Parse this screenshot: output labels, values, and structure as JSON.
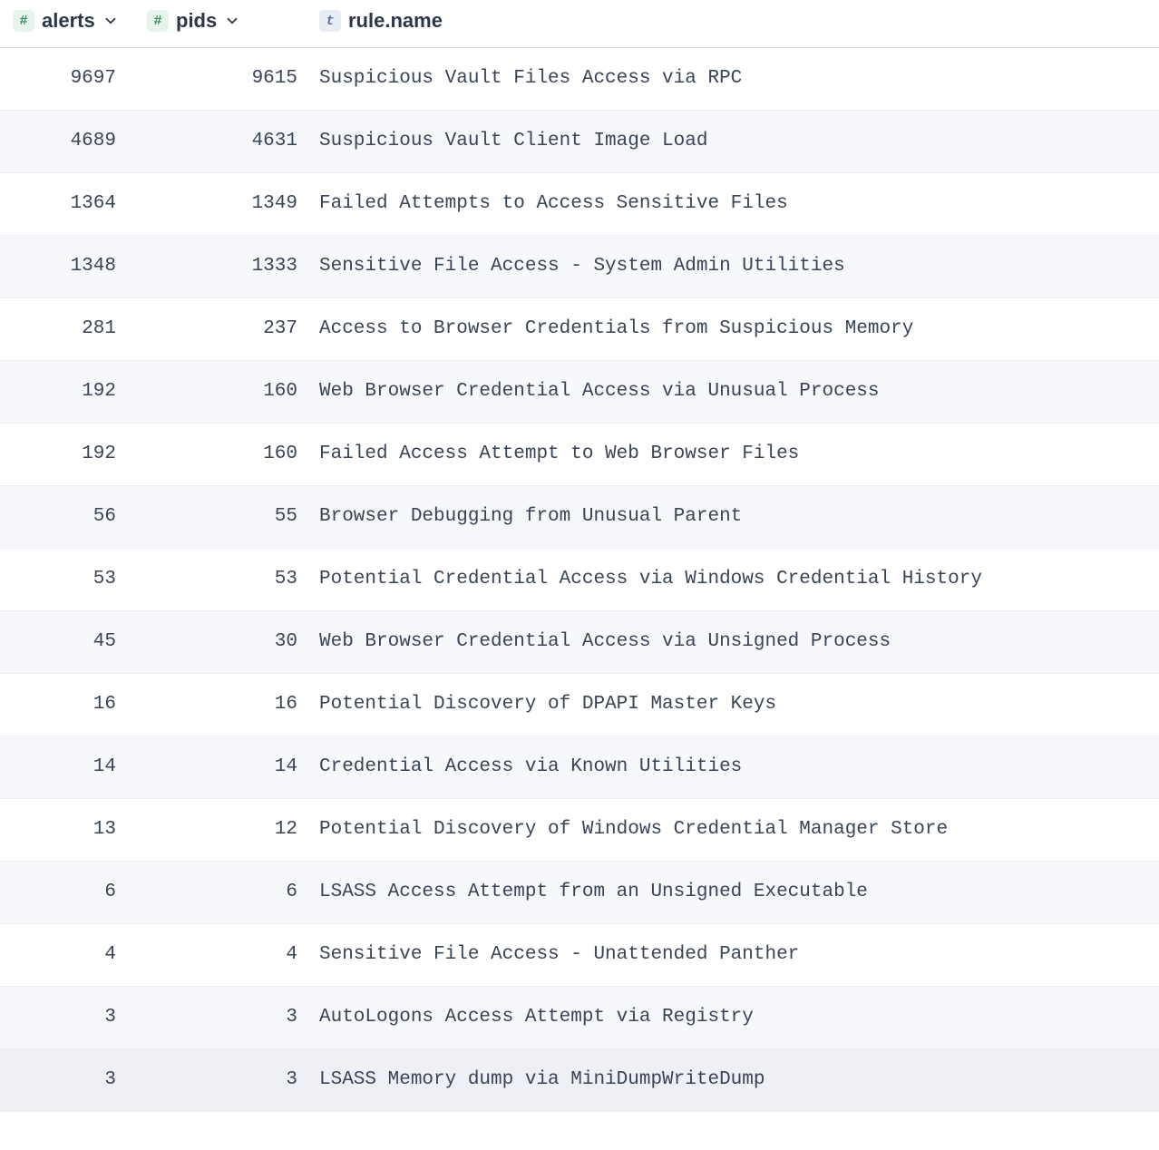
{
  "table": {
    "columns": [
      {
        "key": "alerts",
        "label": "alerts",
        "type": "number",
        "typeGlyph": "#",
        "sortable": true
      },
      {
        "key": "pids",
        "label": "pids",
        "type": "number",
        "typeGlyph": "#",
        "sortable": true
      },
      {
        "key": "rulename",
        "label": "rule.name",
        "type": "text",
        "typeGlyph": "t",
        "sortable": false
      }
    ],
    "rows": [
      {
        "alerts": "9697",
        "pids": "9615",
        "rulename": "Suspicious Vault Files Access via RPC"
      },
      {
        "alerts": "4689",
        "pids": "4631",
        "rulename": "Suspicious Vault Client Image Load"
      },
      {
        "alerts": "1364",
        "pids": "1349",
        "rulename": "Failed Attempts to Access Sensitive Files"
      },
      {
        "alerts": "1348",
        "pids": "1333",
        "rulename": "Sensitive File Access - System Admin Utilities"
      },
      {
        "alerts": "281",
        "pids": "237",
        "rulename": "Access to Browser Credentials from Suspicious Memory"
      },
      {
        "alerts": "192",
        "pids": "160",
        "rulename": "Web Browser Credential Access via Unusual Process"
      },
      {
        "alerts": "192",
        "pids": "160",
        "rulename": "Failed Access Attempt to Web Browser Files"
      },
      {
        "alerts": "56",
        "pids": "55",
        "rulename": "Browser Debugging from Unusual Parent"
      },
      {
        "alerts": "53",
        "pids": "53",
        "rulename": "Potential Credential Access via Windows Credential History"
      },
      {
        "alerts": "45",
        "pids": "30",
        "rulename": "Web Browser Credential Access via Unsigned Process"
      },
      {
        "alerts": "16",
        "pids": "16",
        "rulename": "Potential Discovery of DPAPI Master Keys"
      },
      {
        "alerts": "14",
        "pids": "14",
        "rulename": "Credential Access via Known Utilities"
      },
      {
        "alerts": "13",
        "pids": "12",
        "rulename": "Potential Discovery of Windows Credential Manager Store"
      },
      {
        "alerts": "6",
        "pids": "6",
        "rulename": "LSASS Access Attempt from an Unsigned Executable"
      },
      {
        "alerts": "4",
        "pids": "4",
        "rulename": "Sensitive File Access - Unattended Panther"
      },
      {
        "alerts": "3",
        "pids": "3",
        "rulename": "AutoLogons Access Attempt via Registry"
      },
      {
        "alerts": "3",
        "pids": "3",
        "rulename": "LSASS Memory dump via MiniDumpWriteDump"
      }
    ]
  }
}
